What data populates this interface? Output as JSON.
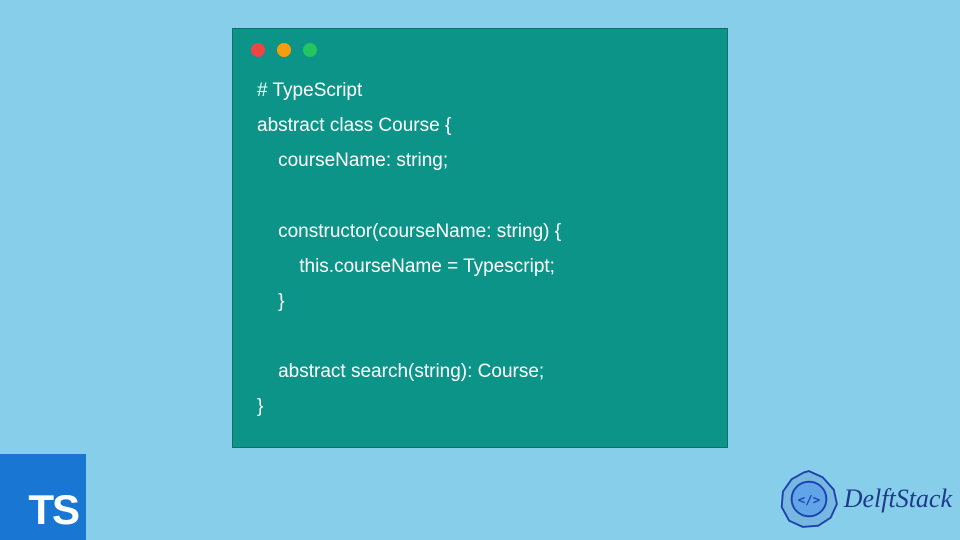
{
  "code": {
    "lines": [
      "# TypeScript",
      "abstract class Course {",
      "    courseName: string;",
      "",
      "    constructor(courseName: string) {",
      "        this.courseName = Typescript;",
      "    }",
      "",
      "    abstract search(string): Course;",
      "}"
    ]
  },
  "ts_badge": "TS",
  "brand": "DelftStack"
}
